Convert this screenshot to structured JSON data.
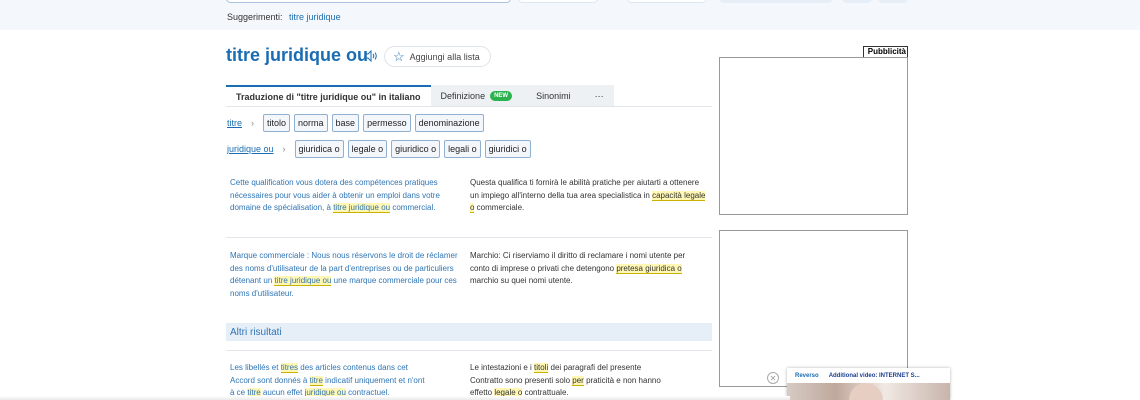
{
  "suggestions": {
    "label": "Suggerimenti:",
    "link": "titre juridique"
  },
  "header": {
    "title": "titre juridique ou",
    "speaker_icon": "speaker-icon",
    "add_to_list": "Aggiungi alla lista",
    "star_icon": "star-icon"
  },
  "tabs": [
    {
      "label": "Traduzione di \"titre juridique ou\" in italiano"
    },
    {
      "label": "Definizione",
      "badge": "NEW"
    },
    {
      "label": "Sinonimi"
    },
    {
      "label": "···"
    }
  ],
  "translations": [
    {
      "source": "titre",
      "arrow": "›",
      "chips": [
        "titolo",
        "norma",
        "base",
        "permesso",
        "denominazione"
      ]
    },
    {
      "source": "juridique ou",
      "arrow": "›",
      "chips": [
        "giuridica o",
        "legale o",
        "giuridico o",
        "legali o",
        "giuridici o"
      ]
    }
  ],
  "examples": [
    {
      "fr": {
        "pre": "Cette qualification vous dotera des compétences pratiques nécessaires pour vous aider à obtenir un emploi dans votre domaine de spécialisation, à ",
        "hl1": "titre juridique ou",
        "mid": "",
        "hl2": "",
        "post": " commercial."
      },
      "it": {
        "pre": "Questa qualifica ti fornirà le abilità pratiche per aiutarti a ottenere un impiego all'interno della tua area specialistica in ",
        "hl1": "capacità legale o",
        "mid": "",
        "hl2": "",
        "post": " commerciale."
      }
    },
    {
      "fr": {
        "pre": "Marque commerciale : Nous nous réservons le droit de réclamer des noms d'utilisateur de la part d'entreprises ou de particuliers détenant un ",
        "hl1": "titre juridique ou",
        "mid": "",
        "hl2": "",
        "post": " une marque commerciale pour ces noms d'utilisateur."
      },
      "it": {
        "pre": "Marchio: Ci riserviamo il diritto di reclamare i nomi utente per conto di imprese o privati che detengono ",
        "hl1": "pretesa giuridica o",
        "mid": "",
        "hl2": "",
        "post": " marchio su quei nomi utente."
      }
    }
  ],
  "more_results": "Altri risultati",
  "example3": {
    "fr_line1_pre": "Les libellés et ",
    "fr_line1_hl": "titres",
    "fr_line1_post": " des articles contenus dans cet",
    "fr_line2_pre": "Accord sont donnés à ",
    "fr_line2_hl": "titre",
    "fr_line2_post": " indicatif uniquement et n'ont",
    "fr_line3_pre": "à ce ",
    "fr_line3_hl1": "titre",
    "fr_line3_mid": " aucun effet ",
    "fr_line3_hl2": "juridique ou",
    "fr_line3_post": " contractuel.",
    "it_line1_pre": "Le intestazioni e i ",
    "it_line1_hl": "titoli",
    "it_line1_post": " dei paragrafi del presente",
    "it_line2_pre": "Contratto sono presenti solo ",
    "it_line2_hl": "per",
    "it_line2_post": " praticità e non hanno",
    "it_line3_pre": "effetto ",
    "it_line3_hl": "legale o",
    "it_line3_post": " contrattuale."
  },
  "ad": {
    "label": "Pubblicità"
  },
  "video": {
    "brand": "Reverso",
    "title": "Additional video: INTERNET S...",
    "close": "✕"
  }
}
